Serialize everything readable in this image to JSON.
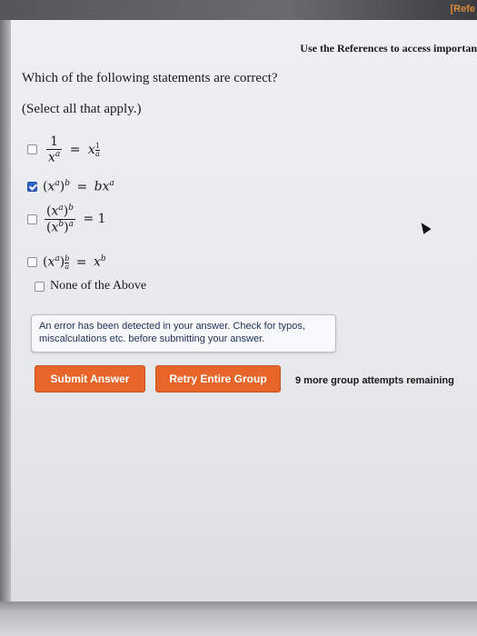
{
  "header": {
    "reference_link": "[Refe",
    "references_notice": "Use the References to access importan"
  },
  "question": {
    "prompt": "Which of the following statements are correct?",
    "instruction": "(Select all that apply.)",
    "options": [
      {
        "label_math": "1/x^a = x^(1/a)",
        "checked": false
      },
      {
        "label_math": "(x^a)^b = bx^a",
        "checked": true
      },
      {
        "label_math": "(x^a)^b / (x^b)^a = 1",
        "checked": false
      },
      {
        "label_math": "(x^a)^(b/a) = x^b",
        "checked": false
      },
      {
        "label": "None of the Above",
        "checked": false
      }
    ]
  },
  "math_parts": {
    "one": "1",
    "x": "x",
    "a": "a",
    "b": "b",
    "eq": "=",
    "lp": "(",
    "rp": ")",
    "bx": "bx",
    "eq1": "= 1"
  },
  "alert": {
    "line1": "An error has been detected in your answer. Check for typos,",
    "line2": "miscalculations etc. before submitting your answer."
  },
  "actions": {
    "submit_label": "Submit Answer",
    "retry_label": "Retry Entire Group",
    "attempts_remaining": "9 more group attempts remaining"
  },
  "colors": {
    "button_orange": "#e8652a",
    "checkbox_blue": "#2f62c9",
    "alert_text": "#1f2f5a"
  }
}
